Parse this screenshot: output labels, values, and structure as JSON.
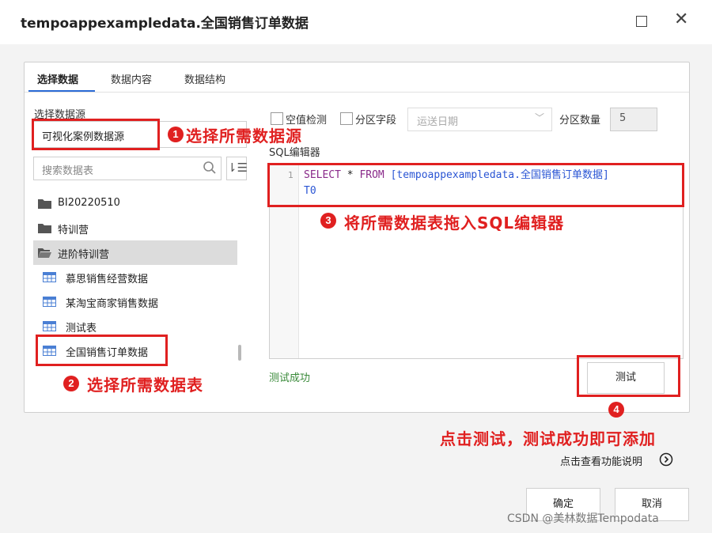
{
  "window": {
    "title": "tempoappexampledata.全国销售订单数据"
  },
  "tabs": [
    {
      "label": "选择数据",
      "active": true
    },
    {
      "label": "数据内容"
    },
    {
      "label": "数据结构"
    }
  ],
  "source": {
    "label": "选择数据源",
    "value": "可视化案例数据源"
  },
  "search": {
    "placeholder": "搜索数据表"
  },
  "tree": [
    {
      "label": "BI20220510",
      "type": "folder"
    },
    {
      "label": "特训营",
      "type": "folder"
    },
    {
      "label": "进阶特训营",
      "type": "folder-open"
    },
    {
      "label": "慕思销售经营数据",
      "type": "table"
    },
    {
      "label": "某淘宝商家销售数据",
      "type": "table"
    },
    {
      "label": "测试表",
      "type": "table"
    },
    {
      "label": "全国销售订单数据",
      "type": "table"
    }
  ],
  "options": {
    "null_check": "空值检测",
    "partition_field": "分区字段",
    "partition_date": "运送日期",
    "partition_count_label": "分区数量",
    "partition_count": "5"
  },
  "editor": {
    "label": "SQL编辑器",
    "line_number": "1",
    "kw_select": "SELECT",
    "star": " * ",
    "kw_from": "FROM",
    "table_ref": " [tempoappexampledata.全国销售订单数据]",
    "line2": "T0"
  },
  "test": {
    "status": "测试成功",
    "button": "测试"
  },
  "annotations": {
    "a1_num": "1",
    "a1_text": "选择所需数据源",
    "a2_num": "2",
    "a2_text": "选择所需数据表",
    "a3_num": "3",
    "a3_text": "将所需数据表拖入SQL编辑器",
    "a4_num": "4",
    "a4_text": "点击测试，测试成功即可添加"
  },
  "help": {
    "link": "点击查看功能说明"
  },
  "footer": {
    "ok": "确定",
    "cancel": "取消"
  },
  "watermark": "CSDN @美林数据Tempodata",
  "colors": {
    "highlight": "#e02020",
    "accent": "#2b6bd6",
    "success": "#3a8a3a"
  }
}
